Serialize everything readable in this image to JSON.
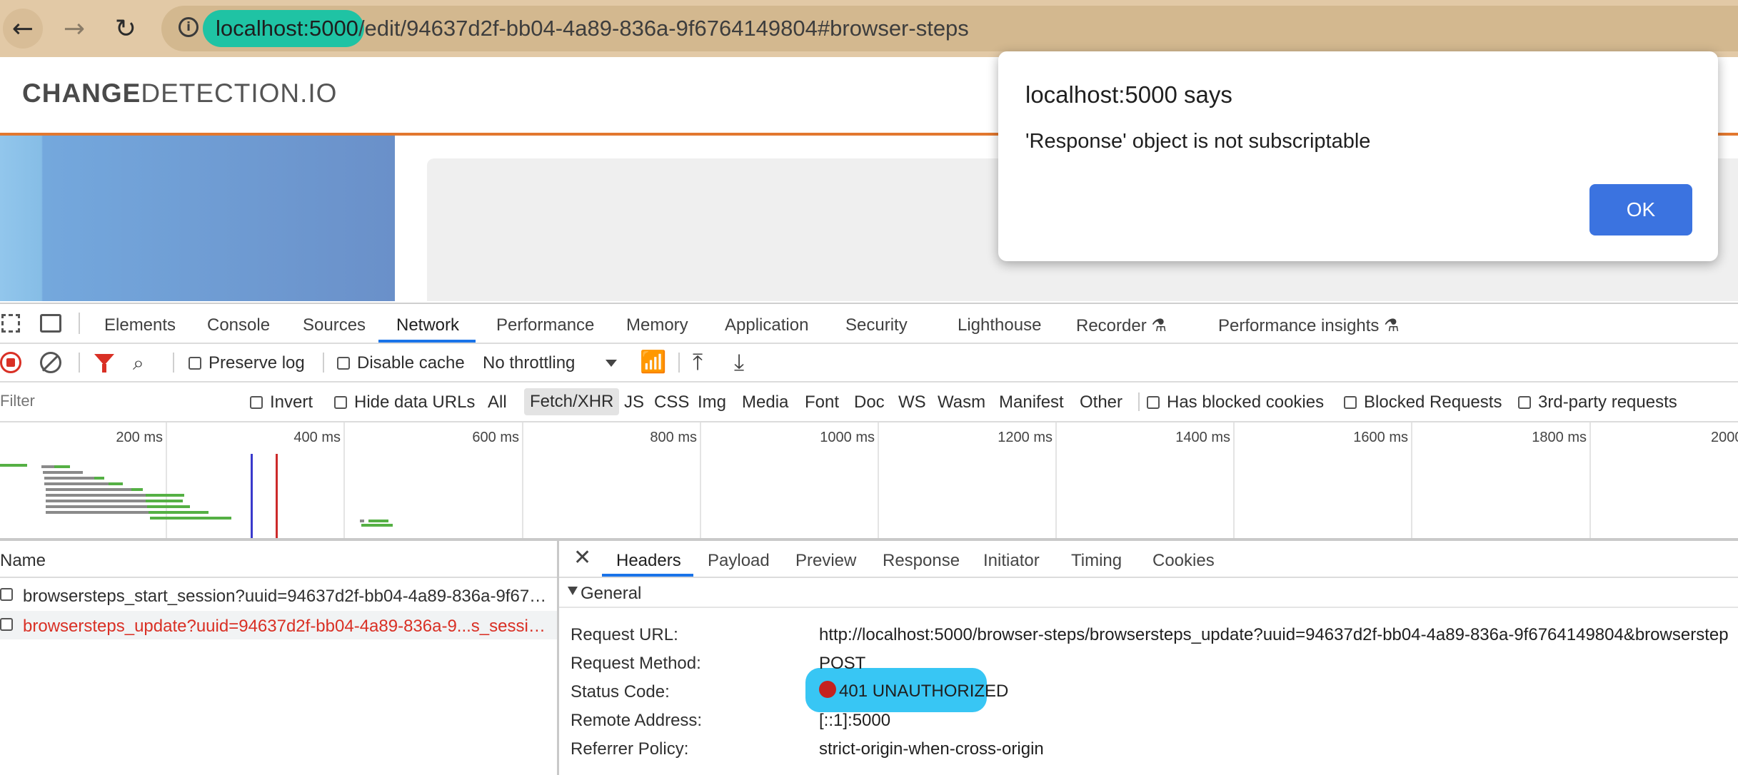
{
  "browser": {
    "url_host": "localhost:5000",
    "url_path": "/edit/94637d2f-bb04-4a89-836a-9f6764149804#browser-steps"
  },
  "page": {
    "brand_bold": "CHANGE",
    "brand_rest": "DETECTION.IO"
  },
  "alert": {
    "title": "localhost:5000 says",
    "message": "'Response' object is not subscriptable",
    "ok_label": "OK"
  },
  "devtools": {
    "tabs": [
      "Elements",
      "Console",
      "Sources",
      "Network",
      "Performance",
      "Memory",
      "Application",
      "Security",
      "Lighthouse",
      "Recorder",
      "Performance insights"
    ],
    "active_tab": "Network",
    "toolbar": {
      "preserve_log": "Preserve log",
      "disable_cache": "Disable cache",
      "throttling": "No throttling"
    },
    "filterbar": {
      "filter_placeholder": "Filter",
      "invert": "Invert",
      "hide_data_urls": "Hide data URLs",
      "types": [
        "All",
        "Fetch/XHR",
        "JS",
        "CSS",
        "Img",
        "Media",
        "Font",
        "Doc",
        "WS",
        "Wasm",
        "Manifest",
        "Other"
      ],
      "active_type": "Fetch/XHR",
      "has_blocked_cookies": "Has blocked cookies",
      "blocked_requests": "Blocked Requests",
      "third_party": "3rd-party requests"
    },
    "timeline": {
      "ticks": [
        "200 ms",
        "400 ms",
        "600 ms",
        "800 ms",
        "1000 ms",
        "1200 ms",
        "1400 ms",
        "1600 ms",
        "1800 ms",
        "2000"
      ]
    },
    "requests": {
      "header": "Name",
      "rows": [
        {
          "name": "browsersteps_start_session?uuid=94637d2f-bb04-4a89-836a-9f676...",
          "error": false
        },
        {
          "name": "browsersteps_update?uuid=94637d2f-bb04-4a89-836a-9...s_sessio...",
          "error": true
        }
      ]
    },
    "details": {
      "tabs": [
        "Headers",
        "Payload",
        "Preview",
        "Response",
        "Initiator",
        "Timing",
        "Cookies"
      ],
      "active_tab": "Headers",
      "section": "General",
      "fields": {
        "request_url_key": "Request URL:",
        "request_url_host": "http://localhost:5000",
        "request_url_rest": "/browser-steps/browsersteps_update?uuid=94637d2f-bb04-4a89-836a-9f6764149804&browserstep",
        "method_key": "Request Method:",
        "method": "POST",
        "status_key": "Status Code:",
        "status": "401 UNAUTHORIZED",
        "remote_key": "Remote Address:",
        "remote": "[::1]:5000",
        "referrer_key": "Referrer Policy:",
        "referrer": "strict-origin-when-cross-origin"
      }
    }
  },
  "colors": {
    "chrome_bg": "#e2c9a6",
    "accent_orange": "#e2782f",
    "devtools_blue": "#1a73e8",
    "error_red": "#c5221f",
    "url_highlight_green": "#1fc3a4",
    "url_highlight_blue": "#38c6f4"
  },
  "icons": [
    "back-arrow-icon",
    "forward-arrow-icon",
    "reload-icon",
    "site-info-icon",
    "inspect-icon",
    "device-toolbar-icon",
    "record-icon",
    "clear-icon",
    "filter-icon",
    "search-icon",
    "network-conditions-icon",
    "upload-icon",
    "download-icon",
    "close-icon",
    "flask-icon"
  ]
}
